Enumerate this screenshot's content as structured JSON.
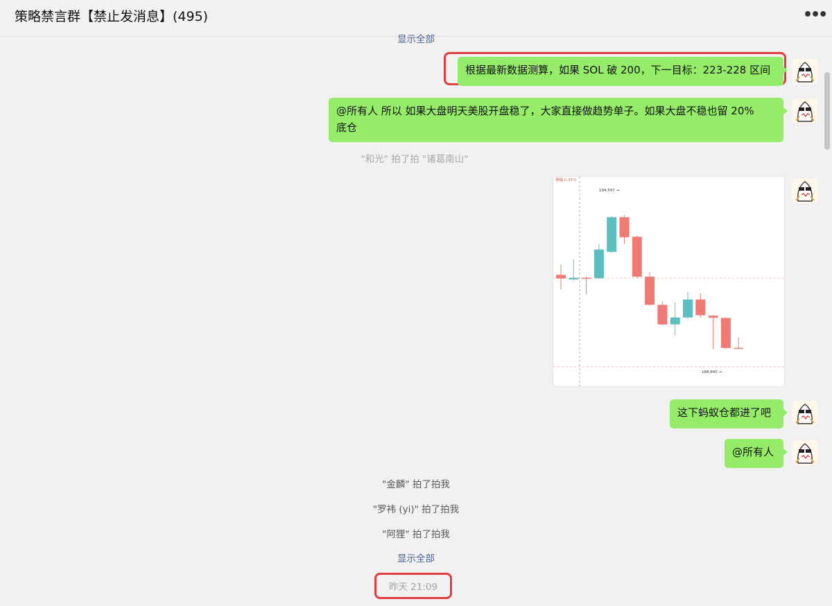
{
  "header": {
    "title": "策略禁言群【禁止发消息】(495)",
    "more_icon": "more-dots-icon"
  },
  "messages": {
    "top_show_all": "显示全部",
    "msg1": "根据最新数据测算，如果 SOL 破 200，下一目标：223-228 区间",
    "msg2_line1": "@所有人 所以 如果大盘明天美股开盘稳了，大家直接做趋势单子。如果大盘不稳也留 20%",
    "msg2_line2": "底仓",
    "pat1": "\"和光\" 拍了拍 \"诸葛南山\"",
    "msg3": "这下蚂蚁仓都进了吧",
    "msg4": "@所有人"
  },
  "system_notices": [
    "\"金麟\" 拍了拍我",
    "\"罗袆 (yi)\" 拍了拍我",
    "\"阿狸\" 拍了拍我"
  ],
  "bottom_show_all": "显示全部",
  "timestamp": "昨天 21:09",
  "chart_data": {
    "type": "candlestick",
    "top_label": "振幅 0.35%",
    "high_label": "194.597 →",
    "low_label": "188.840 →",
    "ylim": [
      188.0,
      195.4
    ],
    "candles": [
      {
        "open": 192.05,
        "close": 191.89,
        "high": 192.5,
        "low": 191.4,
        "dir": "down"
      },
      {
        "open": 191.85,
        "close": 191.92,
        "high": 192.72,
        "low": 191.8,
        "dir": "up"
      },
      {
        "open": 191.92,
        "close": 191.9,
        "high": 191.98,
        "low": 191.2,
        "dir": "down"
      },
      {
        "open": 191.9,
        "close": 193.15,
        "high": 193.4,
        "low": 191.88,
        "dir": "up"
      },
      {
        "open": 193.05,
        "close": 194.55,
        "high": 194.6,
        "low": 193.0,
        "dir": "up"
      },
      {
        "open": 194.55,
        "close": 193.68,
        "high": 194.64,
        "low": 193.4,
        "dir": "down"
      },
      {
        "open": 193.7,
        "close": 191.97,
        "high": 193.75,
        "low": 191.9,
        "dir": "down"
      },
      {
        "open": 191.97,
        "close": 190.75,
        "high": 192.17,
        "low": 190.72,
        "dir": "down"
      },
      {
        "open": 190.75,
        "close": 189.9,
        "high": 190.9,
        "low": 189.85,
        "dir": "down"
      },
      {
        "open": 189.9,
        "close": 190.2,
        "high": 190.85,
        "low": 189.4,
        "dir": "up"
      },
      {
        "open": 190.2,
        "close": 190.98,
        "high": 191.3,
        "low": 190.15,
        "dir": "up"
      },
      {
        "open": 190.98,
        "close": 190.3,
        "high": 191.25,
        "low": 190.2,
        "dir": "down"
      },
      {
        "open": 190.28,
        "close": 190.19,
        "high": 190.31,
        "low": 188.84,
        "dir": "down"
      },
      {
        "open": 190.18,
        "close": 188.88,
        "high": 190.2,
        "low": 188.83,
        "dir": "down"
      },
      {
        "open": 188.88,
        "close": 188.86,
        "high": 189.35,
        "low": 188.84,
        "dir": "down"
      }
    ],
    "colors": {
      "up": "#5bbfc0",
      "down": "#ee7a73"
    }
  },
  "colors": {
    "bubble": "#95ec69",
    "highlight": "#e23c3c",
    "link": "#4a6291"
  }
}
